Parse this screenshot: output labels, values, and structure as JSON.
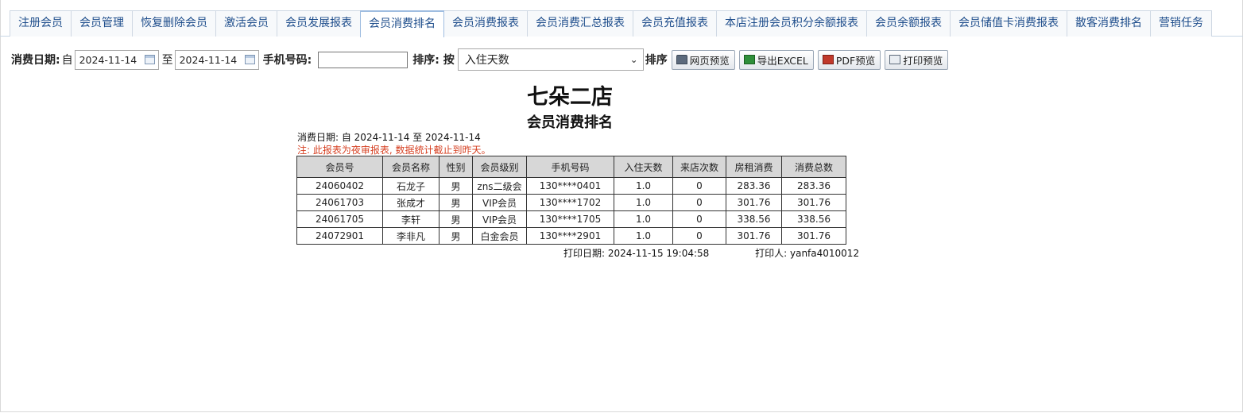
{
  "tabs": [
    {
      "label": "注册会员",
      "active": false
    },
    {
      "label": "会员管理",
      "active": false
    },
    {
      "label": "恢复删除会员",
      "active": false
    },
    {
      "label": "激活会员",
      "active": false
    },
    {
      "label": "会员发展报表",
      "active": false
    },
    {
      "label": "会员消费排名",
      "active": true
    },
    {
      "label": "会员消费报表",
      "active": false
    },
    {
      "label": "会员消费汇总报表",
      "active": false
    },
    {
      "label": "会员充值报表",
      "active": false
    },
    {
      "label": "本店注册会员积分余额报表",
      "active": false
    },
    {
      "label": "会员余额报表",
      "active": false
    },
    {
      "label": "会员储值卡消费报表",
      "active": false
    },
    {
      "label": "散客消费排名",
      "active": false
    },
    {
      "label": "营销任务",
      "active": false
    }
  ],
  "toolbar": {
    "date_label": "消费日期:",
    "from_label": "自",
    "from_date": "2024-11-14",
    "to_label": "至",
    "to_date": "2024-11-14",
    "phone_label": "手机号码:",
    "phone_value": "",
    "sort_label": "排序: 按",
    "sort_value": "入住天数",
    "sort_suffix": "排序",
    "btn_web": "网页预览",
    "btn_excel": "导出EXCEL",
    "btn_pdf": "PDF预览",
    "btn_print": "打印预览"
  },
  "report": {
    "store": "七朵二店",
    "title": "会员消费排名",
    "date_range": "消费日期: 自 2024-11-14 至 2024-11-14",
    "note": "注: 此报表为夜审报表, 数据统计截止到昨天。",
    "columns": [
      "会员号",
      "会员名称",
      "性别",
      "会员级别",
      "手机号码",
      "入住天数",
      "来店次数",
      "房租消费",
      "消费总数"
    ],
    "rows": [
      [
        "24060402",
        "石龙子",
        "男",
        "zns二级会",
        "130****0401",
        "1.0",
        "0",
        "283.36",
        "283.36"
      ],
      [
        "24061703",
        "张成才",
        "男",
        "VIP会员",
        "130****1702",
        "1.0",
        "0",
        "301.76",
        "301.76"
      ],
      [
        "24061705",
        "李轩",
        "男",
        "VIP会员",
        "130****1705",
        "1.0",
        "0",
        "338.56",
        "338.56"
      ],
      [
        "24072901",
        "李非凡",
        "男",
        "白金会员",
        "130****2901",
        "1.0",
        "0",
        "301.76",
        "301.76"
      ]
    ],
    "print_date": "打印日期: 2024-11-15 19:04:58",
    "printer": "打印人: yanfa4010012"
  }
}
